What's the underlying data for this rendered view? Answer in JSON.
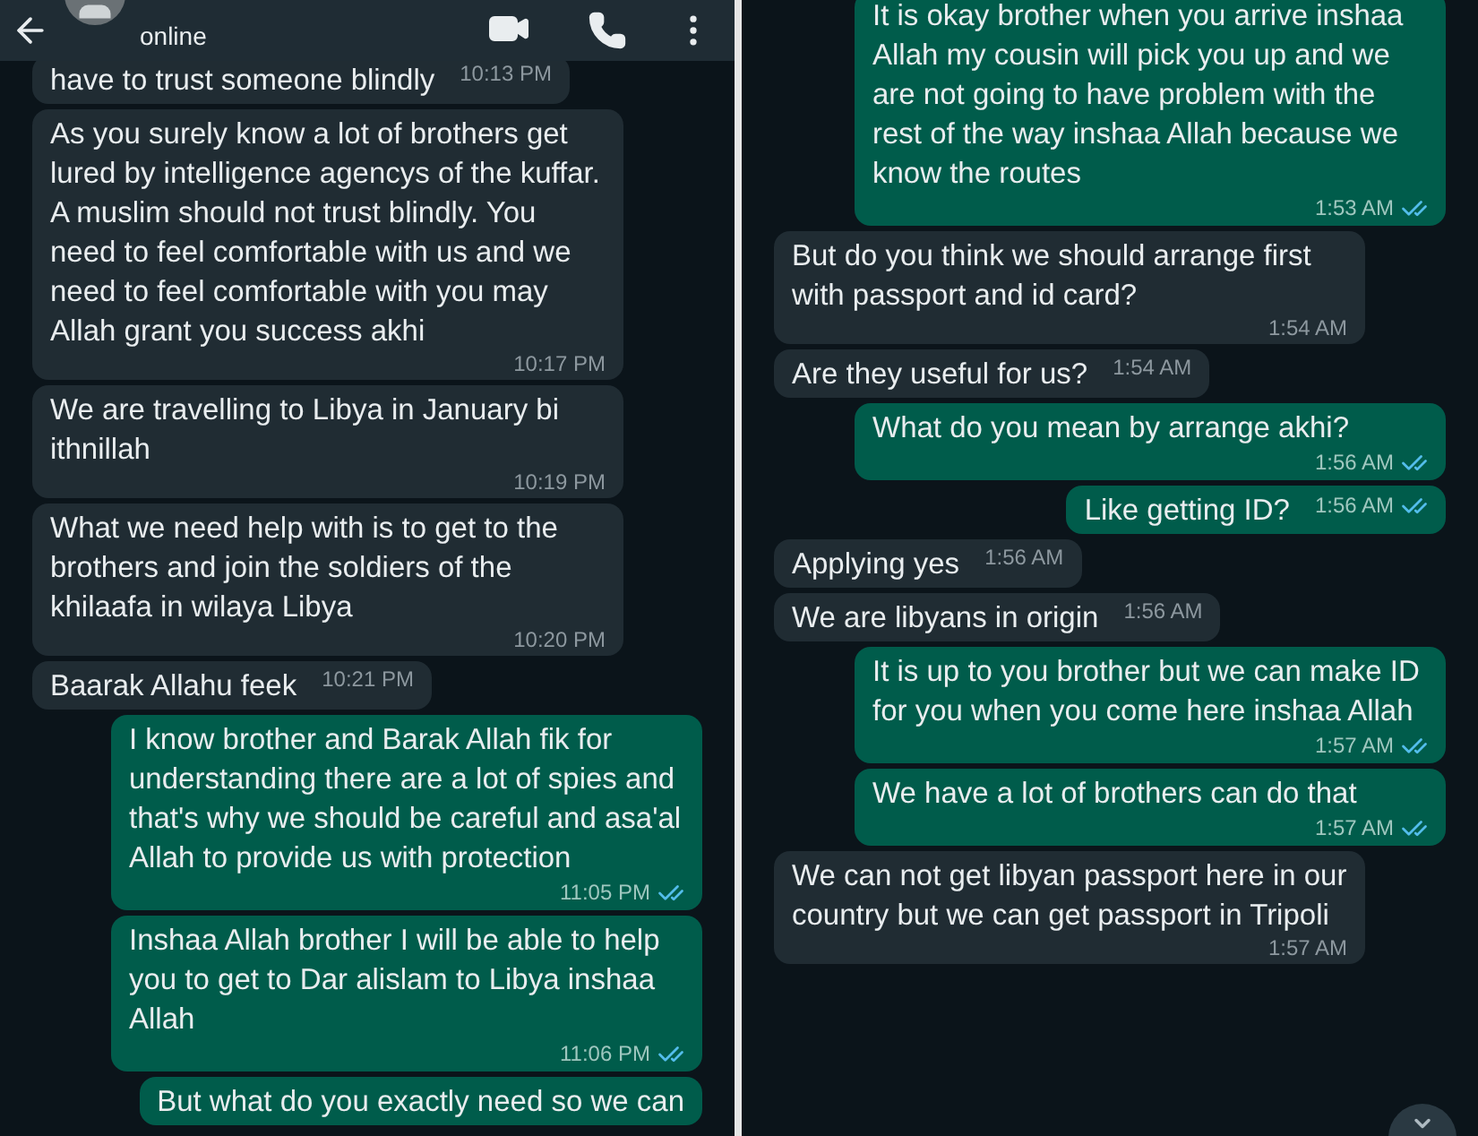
{
  "panes": [
    {
      "header": {
        "status": "online"
      },
      "messages": [
        {
          "kind": "incoming",
          "text": "have to trust someone blindly",
          "time": "10:13 PM"
        },
        {
          "kind": "incoming",
          "text": "As you surely know a lot of brothers get lured by intelligence agencys of the kuffar. A muslim should not trust blindly. You need to feel comfortable with us and we need to feel comfortable with you may Allah grant you success akhi",
          "time": "10:17 PM"
        },
        {
          "kind": "incoming",
          "text": "We are travelling to Libya in January bi ithnillah",
          "time": "10:19 PM"
        },
        {
          "kind": "incoming",
          "text": "What we need help with is to get to the brothers and join the soldiers of the khilaafa in wilaya Libya",
          "time": "10:20 PM"
        },
        {
          "kind": "incoming",
          "text": "Baarak Allahu feek",
          "time": "10:21 PM"
        },
        {
          "kind": "outgoing",
          "text": "I know brother and Barak Allah fik for understanding there are a lot of spies and that's why we should be careful and asa'al Allah to provide us with protection",
          "time": "11:05 PM",
          "read": true
        },
        {
          "kind": "outgoing",
          "text": "Inshaa Allah brother I will be able to help you to get to Dar alislam to Libya inshaa Allah",
          "time": "11:06 PM",
          "read": true
        },
        {
          "kind": "outgoing",
          "text": "But what do you exactly need so we can"
        }
      ]
    },
    {
      "messages": [
        {
          "kind": "outgoing",
          "text": "It is okay brother when you arrive inshaa Allah my cousin will pick you up and we are not going to have problem with the rest of the way inshaa Allah because we know the routes",
          "time": "1:53 AM",
          "read": true
        },
        {
          "kind": "incoming",
          "text": "But do you think we should arrange first with passport and id card?",
          "time": "1:54 AM"
        },
        {
          "kind": "incoming",
          "text": "Are they useful for us?",
          "time": "1:54 AM"
        },
        {
          "kind": "outgoing",
          "text": "What do you mean by arrange akhi?",
          "time": "1:56 AM",
          "read": true
        },
        {
          "kind": "outgoing",
          "text": "Like getting ID?",
          "time": "1:56 AM",
          "read": true
        },
        {
          "kind": "incoming",
          "text": "Applying yes",
          "time": "1:56 AM"
        },
        {
          "kind": "incoming",
          "text": "We are libyans in origin",
          "time": "1:56 AM"
        },
        {
          "kind": "outgoing",
          "text": "It is up to you brother but we can make ID for you when you come here inshaa Allah",
          "time": "1:57 AM",
          "read": true
        },
        {
          "kind": "outgoing",
          "text": "We have a lot of brothers can do that",
          "time": "1:57 AM",
          "read": true
        },
        {
          "kind": "incoming",
          "text": "We can not get libyan passport here in our country but we can get passport in Tripoli",
          "time": "1:57 AM"
        }
      ]
    }
  ]
}
